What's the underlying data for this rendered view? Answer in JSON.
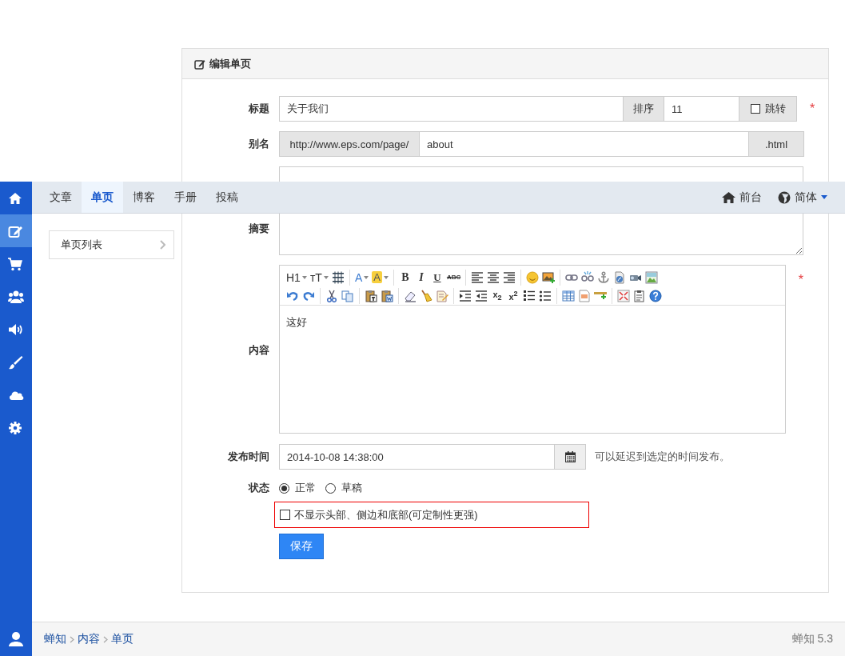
{
  "sidebar": {
    "items": [
      {
        "selected": false
      },
      {
        "selected": true
      },
      {
        "selected": false
      },
      {
        "selected": false
      },
      {
        "selected": false
      },
      {
        "selected": false
      },
      {
        "selected": false
      },
      {
        "selected": false
      }
    ]
  },
  "navbar": {
    "tabs": [
      {
        "label": "文章",
        "selected": false
      },
      {
        "label": "单页",
        "selected": true
      },
      {
        "label": "博客",
        "selected": false
      },
      {
        "label": "手册",
        "selected": false
      },
      {
        "label": "投稿",
        "selected": false
      }
    ],
    "frontend_link": {
      "label": "前台"
    },
    "language_menu": {
      "label": "简体",
      "dropdown": true
    }
  },
  "submenu": {
    "items": [
      {
        "label": "单页列表"
      }
    ]
  },
  "panel": {
    "title": "编辑单页",
    "fields": [
      {
        "kind": "title",
        "label": "标题",
        "value": "关于我们",
        "order_label": "排序",
        "order_value": "11",
        "jump_label": "跳转",
        "jump_checked": false,
        "required_mark": "*"
      },
      {
        "kind": "alias",
        "label": "别名",
        "prefix": "http://www.eps.com/page/",
        "value": "about",
        "suffix": ".html"
      },
      {
        "kind": "text"
      },
      {
        "kind": "textarea",
        "label": "摘要"
      },
      {
        "kind": "editor",
        "label": "内容",
        "required_mark": "*",
        "content": "这好",
        "toolbar": [
          [
            [
              {
                "kind": "text",
                "label": "H1",
                "dropdown": true
              },
              {
                "kind": "text",
                "label": "тT",
                "dropdown": true
              },
              {
                "kind": "spacing"
              }
            ],
            [
              {
                "kind": "fontcolor",
                "label": "A",
                "dropdown": true
              },
              {
                "kind": "highlight",
                "label": "A",
                "dropdown": true
              }
            ],
            [
              {
                "kind": "bold",
                "label": "B"
              },
              {
                "kind": "italic",
                "label": "I"
              },
              {
                "kind": "underline",
                "label": "U"
              },
              {
                "kind": "strike",
                "label": "ABC"
              }
            ],
            [
              {
                "kind": "alignleft"
              },
              {
                "kind": "aligncenter"
              },
              {
                "kind": "alignright"
              }
            ],
            [
              {
                "kind": "smiley"
              },
              {
                "kind": "imageadd"
              }
            ],
            [
              {
                "kind": "link"
              },
              {
                "kind": "unlink"
              },
              {
                "kind": "anchor"
              },
              {
                "kind": "flash"
              },
              {
                "kind": "video"
              },
              {
                "kind": "picture"
              }
            ]
          ],
          [
            [
              {
                "kind": "undo"
              },
              {
                "kind": "redo"
              }
            ],
            [
              {
                "kind": "cut"
              },
              {
                "kind": "copy"
              }
            ],
            [
              {
                "kind": "pastetext"
              },
              {
                "kind": "pasteword"
              }
            ],
            [
              {
                "kind": "eraser"
              },
              {
                "kind": "broom"
              },
              {
                "kind": "note"
              }
            ],
            [
              {
                "kind": "indent"
              },
              {
                "kind": "outdent"
              },
              {
                "kind": "subscript",
                "label": "x$_{2}$"
              },
              {
                "kind": "superscript",
                "label": "x$^{2}$"
              },
              {
                "kind": "orderedlist"
              },
              {
                "kind": "bulletlist"
              }
            ],
            [
              {
                "kind": "table"
              },
              {
                "kind": "code"
              },
              {
                "kind": "rule"
              }
            ],
            [
              {
                "kind": "fullscreen"
              },
              {
                "kind": "clipboard"
              },
              {
                "kind": "help"
              }
            ]
          ]
        ]
      },
      {
        "kind": "datetime",
        "label": "发布时间",
        "value": "2014-10-08 14:38:00",
        "help": "可以延迟到选定的时间发布。"
      },
      {
        "kind": "radios",
        "label": "状态",
        "options": [
          {
            "label": "正常",
            "selected": true
          },
          {
            "label": "草稿",
            "selected": false
          }
        ]
      },
      {
        "kind": "checkbox",
        "label": "不显示头部、侧边和底部(可定制性更强)",
        "checked": false,
        "highlighted": true
      },
      {
        "kind": "submit",
        "label": "保存"
      }
    ]
  },
  "footer": {
    "breadcrumb": [
      "蝉知",
      "内容",
      "单页"
    ],
    "version": "蝉知 5.3"
  }
}
